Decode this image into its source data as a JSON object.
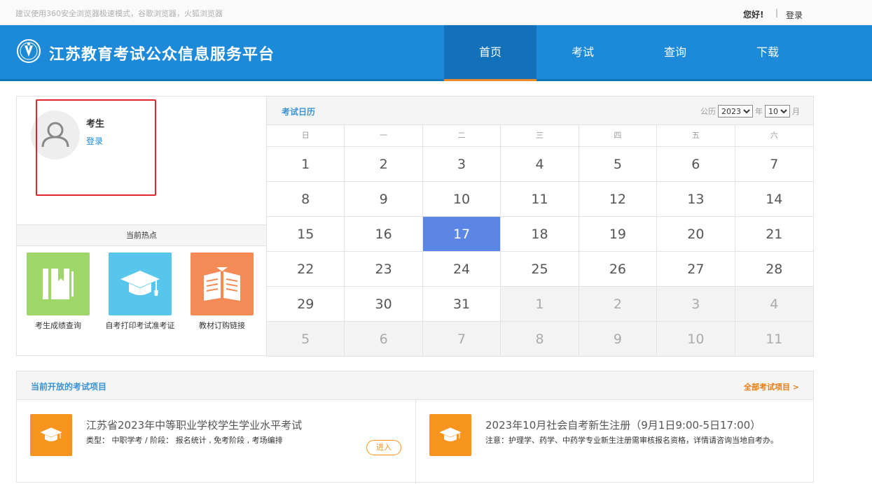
{
  "topbar": {
    "browser_tip": "建议使用360安全浏览器极速模式，谷歌浏览器，火狐浏览器",
    "hello": "您好!",
    "separator": "|",
    "login": "登录"
  },
  "header": {
    "site_title": "江苏教育考试公众信息服务平台",
    "logo_icon": "exam-emblem-icon",
    "nav": [
      {
        "label": "首页",
        "active": true
      },
      {
        "label": "考试",
        "active": false
      },
      {
        "label": "查询",
        "active": false
      },
      {
        "label": "下载",
        "active": false
      }
    ]
  },
  "user_panel": {
    "name": "考生",
    "login_link": "登录",
    "avatar_icon": "user-avatar-icon",
    "hot_title": "当前热点",
    "hot_items": [
      {
        "label": "考生成绩查询",
        "icon": "book-icon",
        "color": "#9fd66a"
      },
      {
        "label": "自考打印考试准考证",
        "icon": "graduation-cap-icon",
        "color": "#58c6ec"
      },
      {
        "label": "教材订购链接",
        "icon": "open-book-icon",
        "color": "#f48b57"
      }
    ]
  },
  "calendar": {
    "title": "考试日历",
    "calendar_label": "公历",
    "year": "2023",
    "year_unit": "年",
    "month": "10",
    "month_unit": "月",
    "weekdays": [
      "日",
      "一",
      "二",
      "三",
      "四",
      "五",
      "六"
    ],
    "selected_day": 17,
    "days": [
      {
        "d": "1",
        "other": false
      },
      {
        "d": "2",
        "other": false
      },
      {
        "d": "3",
        "other": false
      },
      {
        "d": "4",
        "other": false
      },
      {
        "d": "5",
        "other": false
      },
      {
        "d": "6",
        "other": false
      },
      {
        "d": "7",
        "other": false
      },
      {
        "d": "8",
        "other": false
      },
      {
        "d": "9",
        "other": false
      },
      {
        "d": "10",
        "other": false
      },
      {
        "d": "11",
        "other": false
      },
      {
        "d": "12",
        "other": false
      },
      {
        "d": "13",
        "other": false
      },
      {
        "d": "14",
        "other": false
      },
      {
        "d": "15",
        "other": false
      },
      {
        "d": "16",
        "other": false
      },
      {
        "d": "17",
        "other": false
      },
      {
        "d": "18",
        "other": false
      },
      {
        "d": "19",
        "other": false
      },
      {
        "d": "20",
        "other": false
      },
      {
        "d": "21",
        "other": false
      },
      {
        "d": "22",
        "other": false
      },
      {
        "d": "23",
        "other": false
      },
      {
        "d": "24",
        "other": false
      },
      {
        "d": "25",
        "other": false
      },
      {
        "d": "26",
        "other": false
      },
      {
        "d": "27",
        "other": false
      },
      {
        "d": "28",
        "other": false
      },
      {
        "d": "29",
        "other": false
      },
      {
        "d": "30",
        "other": false
      },
      {
        "d": "31",
        "other": false
      },
      {
        "d": "1",
        "other": true
      },
      {
        "d": "2",
        "other": true
      },
      {
        "d": "3",
        "other": true
      },
      {
        "d": "4",
        "other": true
      },
      {
        "d": "5",
        "other": true
      },
      {
        "d": "6",
        "other": true
      },
      {
        "d": "7",
        "other": true
      },
      {
        "d": "8",
        "other": true
      },
      {
        "d": "9",
        "other": true
      },
      {
        "d": "10",
        "other": true
      },
      {
        "d": "11",
        "other": true
      }
    ]
  },
  "exams": {
    "title": "当前开放的考试项目",
    "all_link": "全部考试项目 >",
    "items": [
      {
        "title": "江苏省2023年中等职业学校学生学业水平考试",
        "meta": "类型： 中职学考 / 阶段： 报名统计 , 免考阶段 , 考场编排",
        "button": "进入",
        "icon": "graduation-cap-icon"
      },
      {
        "title": "2023年10月社会自考新生注册（9月1日9:00-5日17:00）",
        "meta": "注意：护理学、药学、中药学专业新生注册需审核报名资格，详情请咨询当地自考办。",
        "icon": "graduation-cap-icon"
      }
    ]
  }
}
